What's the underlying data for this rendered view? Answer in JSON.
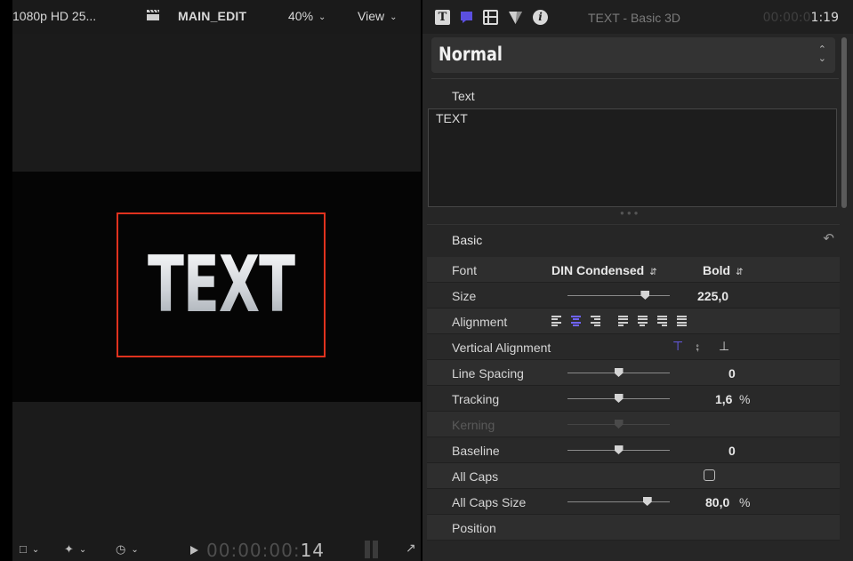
{
  "viewer": {
    "format": "1080p HD 25...",
    "project": "MAIN_EDIT",
    "zoom": "40%",
    "view_label": "View",
    "title_text": "TEXT",
    "timecode_dim": "00:00:00:",
    "timecode_bright": "14"
  },
  "inspector": {
    "title": "TEXT - Basic 3D",
    "timecode_dim": "00:00:0",
    "timecode_bright": "1:19",
    "preset": "Normal",
    "text_label": "Text",
    "text_value": "TEXT",
    "section_title": "Basic",
    "rows": {
      "font": {
        "label": "Font",
        "family": "DIN Condensed",
        "weight": "Bold"
      },
      "size": {
        "label": "Size",
        "value": "225,0",
        "slider": 0.76
      },
      "alignment": {
        "label": "Alignment",
        "selected": "center"
      },
      "vertical_alignment": {
        "label": "Vertical Alignment",
        "selected": "top"
      },
      "line_spacing": {
        "label": "Line Spacing",
        "value": "0",
        "slider": 0.5
      },
      "tracking": {
        "label": "Tracking",
        "value": "1,6",
        "unit": "%",
        "slider": 0.5
      },
      "kerning": {
        "label": "Kerning",
        "slider": 0.5
      },
      "baseline": {
        "label": "Baseline",
        "value": "0",
        "slider": 0.5
      },
      "all_caps": {
        "label": "All Caps",
        "checked": false
      },
      "all_caps_size": {
        "label": "All Caps Size",
        "value": "80,0",
        "unit": "%",
        "slider": 0.78
      },
      "position": {
        "label": "Position"
      }
    }
  },
  "colors": {
    "accent": "#6f63ff",
    "selection_box": "#e0321e"
  }
}
